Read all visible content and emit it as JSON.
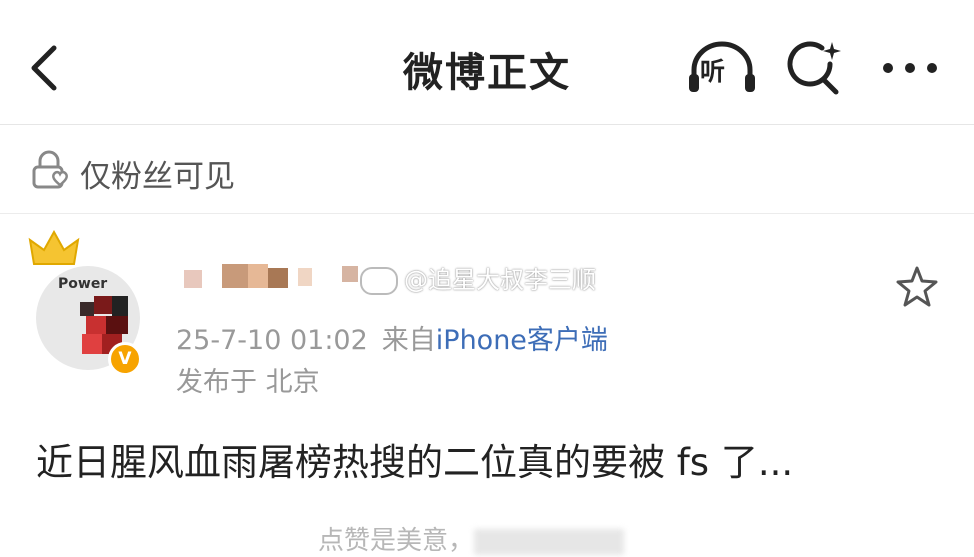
{
  "nav": {
    "title": "微博正文",
    "listen_label": "听"
  },
  "visibility": {
    "label": "仅粉丝可见"
  },
  "post": {
    "avatar_text": "Power",
    "timestamp": "25-7-10 01:02",
    "source_prefix": "来自",
    "source": "iPhone客户端",
    "location": "发布于 北京",
    "content": "近日腥风血雨屠榜热搜的二位真的要被 fs 了...",
    "footer_text": "点赞是美意，"
  },
  "watermark": {
    "text": "@追星大叔李三顺"
  },
  "colors": {
    "link": "#3d6db7",
    "meta": "#999999",
    "badge": "#f7a300",
    "crown": "#f5c431"
  },
  "icons": [
    "back-icon",
    "headphones-icon",
    "search-sparkle-icon",
    "more-icon",
    "lock-heart-icon",
    "crown-icon",
    "verified-badge-icon",
    "star-icon"
  ]
}
